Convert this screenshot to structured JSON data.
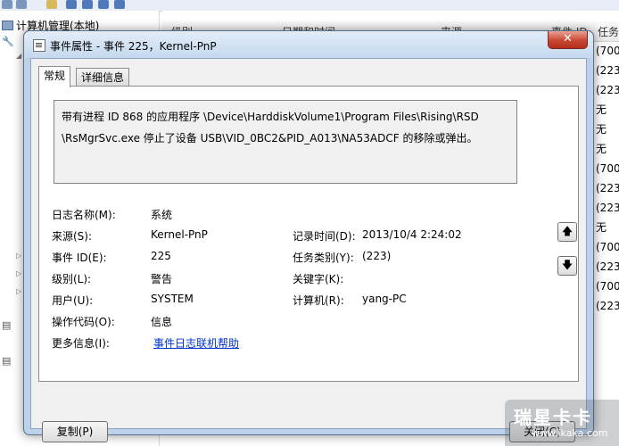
{
  "background": {
    "tree_root_label": "计算机管理(本地)",
    "list_columns": [
      "级别",
      "日期和时间",
      "来源",
      "事件 ID",
      "任务类"
    ],
    "side_values": [
      "(700",
      "(223",
      "(223",
      "无",
      "无",
      "无",
      "(700",
      "(223",
      "(223",
      "无",
      "(700",
      "(223",
      "(700",
      "(223"
    ]
  },
  "dialog": {
    "title": "事件属性 - 事件 225，Kernel-PnP",
    "close_glyph": "✕",
    "tabs": [
      {
        "label": "常规",
        "active": true
      },
      {
        "label": "详细信息",
        "active": false
      }
    ],
    "description": {
      "line1": "带有进程 ID 868 的应用程序 \\Device\\HarddiskVolume1\\Program Files\\Rising\\RSD",
      "line2": "\\RsMgrSvc.exe 停止了设备 USB\\VID_0BC2&PID_A013\\NA53ADCF 的移除或弹出。"
    },
    "scroll_up_glyph": "🡅",
    "scroll_down_glyph": "🡇",
    "fields": {
      "log_name_label": "日志名称(M):",
      "log_name_value": "系统",
      "source_label": "来源(S):",
      "source_value": "Kernel-PnP",
      "logged_label": "记录时间(D):",
      "logged_value": "2013/10/4 2:24:02",
      "event_id_label": "事件 ID(E):",
      "event_id_value": "225",
      "task_label": "任务类别(Y):",
      "task_value": "(223)",
      "level_label": "级别(L):",
      "level_value": "警告",
      "keywords_label": "关键字(K):",
      "keywords_value": "",
      "user_label": "用户(U):",
      "user_value": "SYSTEM",
      "computer_label": "计算机(R):",
      "computer_value": "yang-PC",
      "opcode_label": "操作代码(O):",
      "opcode_value": "信息",
      "more_info_label": "更多信息(I):",
      "more_info_link": "事件日志联机帮助"
    },
    "buttons": {
      "copy": "复制(P)",
      "close": "关闭(C)"
    }
  },
  "watermark": {
    "main": "瑞星卡卡",
    "url": "www.ikaka.com"
  }
}
